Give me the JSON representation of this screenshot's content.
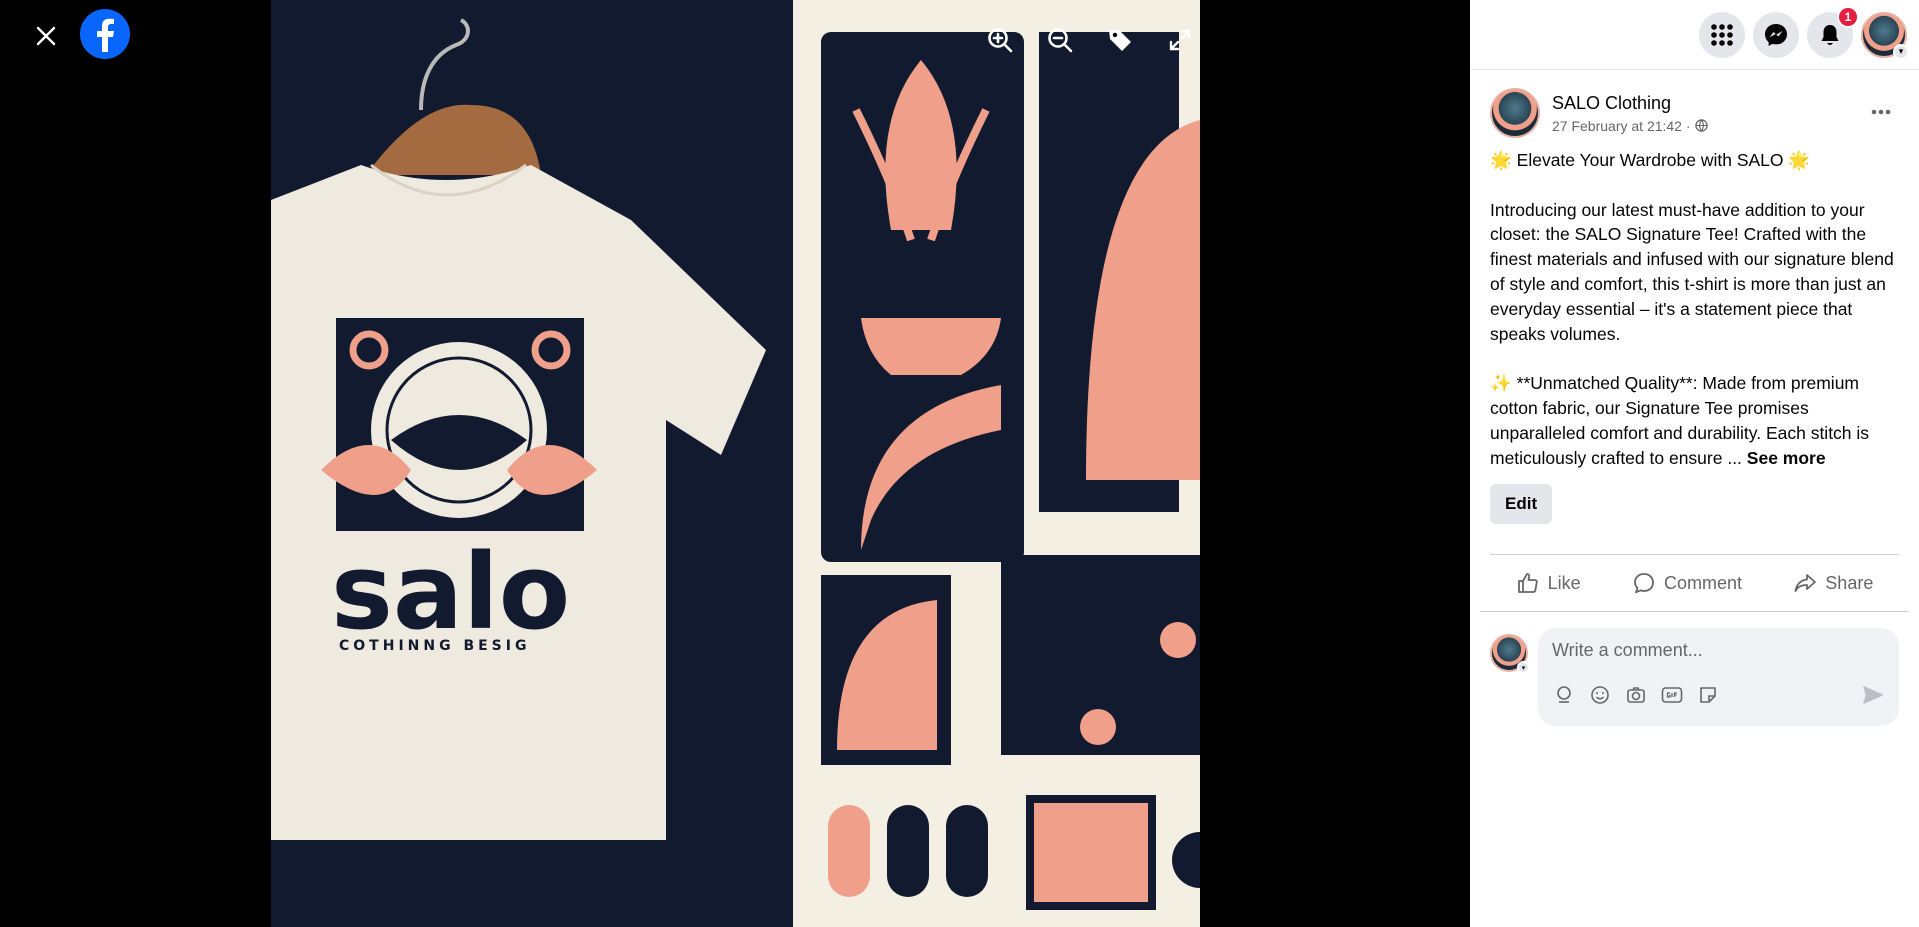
{
  "viewer": {
    "close_icon": "close-icon",
    "logo_icon": "facebook-logo",
    "tools": [
      "zoom-in-icon",
      "zoom-out-icon",
      "tag-icon",
      "fullscreen-icon"
    ],
    "photo": {
      "brand_text": "salo",
      "tagline": "COTHINNG BESIG"
    }
  },
  "topbar": {
    "menu_icon": "grid-menu-icon",
    "messenger_icon": "messenger-icon",
    "notifications_icon": "bell-icon",
    "notifications_count": "1"
  },
  "post": {
    "author": "SALO Clothing",
    "timestamp": "27 February at 21:42 ·",
    "privacy_icon": "globe-icon",
    "text": "🌟 Elevate Your Wardrobe with SALO 🌟\n\nIntroducing our latest must-have addition to your closet: the SALO Signature Tee! Crafted with the finest materials and infused with our signature blend of style and comfort, this t-shirt is more than just an everyday essential – it's a statement piece that speaks volumes.\n\n✨ **Unmatched Quality**: Made from premium cotton fabric, our Signature Tee promises unparalleled comfort and durability. Each stitch is meticulously crafted to ensure ... ",
    "see_more": "See more",
    "edit_label": "Edit"
  },
  "actions": {
    "like": "Like",
    "comment": "Comment",
    "share": "Share"
  },
  "comment_box": {
    "placeholder": "Write a comment..."
  },
  "colors": {
    "facebook_blue": "#0866ff",
    "badge_red": "#e41e3f",
    "navy": "#111a2e",
    "coral": "#f0a08a",
    "cream": "#f4efe3"
  }
}
